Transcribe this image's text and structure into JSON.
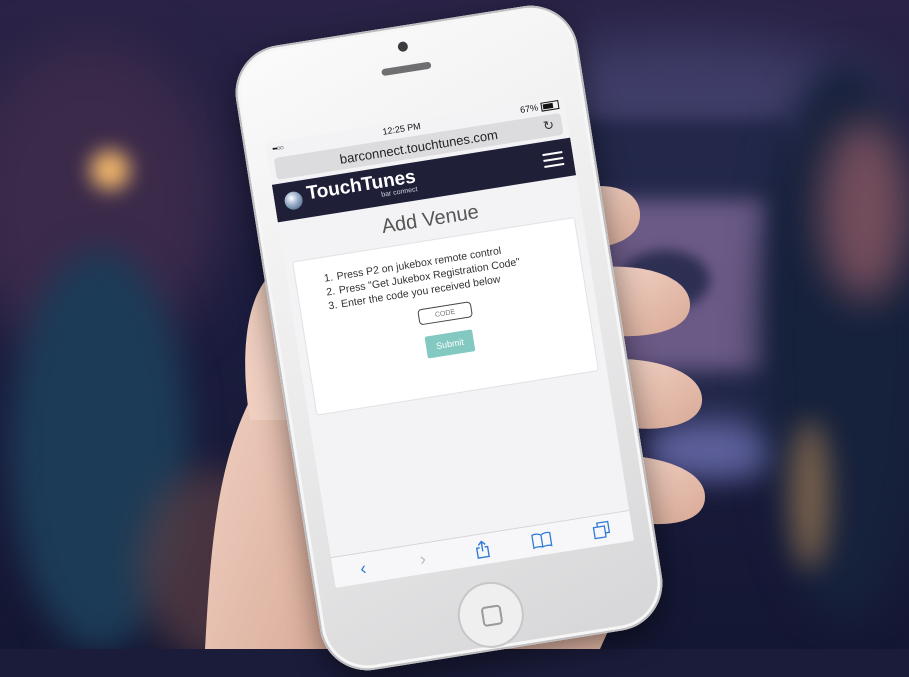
{
  "status": {
    "time": "12:25 PM",
    "battery": "67%",
    "signal": "•••○○"
  },
  "browser": {
    "url": "barconnect.touchtunes.com"
  },
  "app": {
    "brand": "TouchTunes",
    "brand_sub": "bar connect"
  },
  "page": {
    "title": "Add Venue",
    "steps": [
      {
        "num": "1.",
        "text": "Press P2 on jukebox remote control"
      },
      {
        "num": "2.",
        "text": "Press \"Get Jukebox Registration Code\""
      },
      {
        "num": "3.",
        "text": "Enter the code you received below"
      }
    ],
    "code_placeholder": "CODE",
    "submit_label": "Submit"
  },
  "icons": {
    "reload": "reload-icon",
    "menu": "hamburger-menu-icon",
    "back": "back-chevron-icon",
    "forward": "forward-chevron-icon",
    "share": "share-icon",
    "bookmarks": "bookmarks-icon",
    "tabs": "tabs-icon"
  },
  "colors": {
    "header": "#1f2038",
    "submit": "#83c9c2",
    "toolbar_icon": "#2f7bd9"
  }
}
